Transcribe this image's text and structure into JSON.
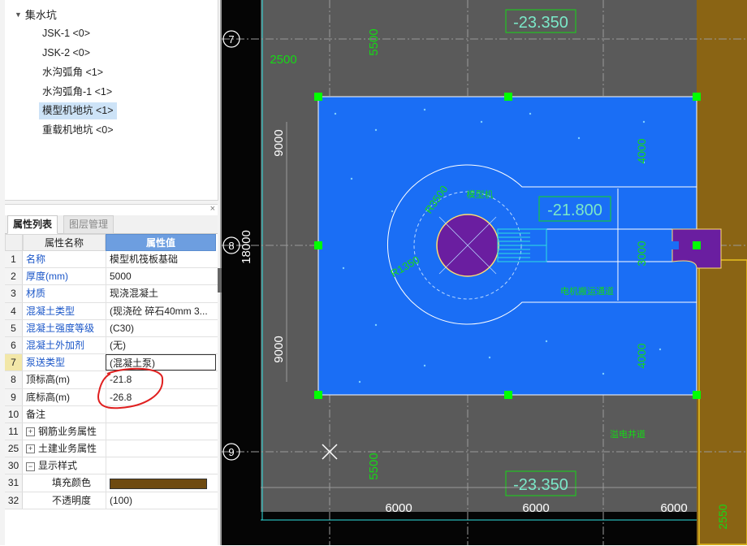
{
  "tree": {
    "root_label": "集水坑",
    "items": [
      {
        "label": "JSK-1 <0>",
        "selected": false
      },
      {
        "label": "JSK-2 <0>",
        "selected": false
      },
      {
        "label": "水沟弧角 <1>",
        "selected": false
      },
      {
        "label": "水沟弧角-1 <1>",
        "selected": false
      },
      {
        "label": "模型机地坑 <1>",
        "selected": true
      },
      {
        "label": "重载机地坑 <0>",
        "selected": false
      }
    ]
  },
  "panel": {
    "close_glyph": "×",
    "tabs": [
      {
        "label": "属性列表",
        "active": true
      },
      {
        "label": "图层管理",
        "active": false
      }
    ],
    "headers": {
      "name": "属性名称",
      "value": "属性值"
    },
    "rows": [
      {
        "num": "1",
        "name": "名称",
        "value": "模型机筏板基础",
        "blue": true
      },
      {
        "num": "2",
        "name": "厚度(mm)",
        "value": "5000",
        "blue": true
      },
      {
        "num": "3",
        "name": "材质",
        "value": "现浇混凝土",
        "blue": true
      },
      {
        "num": "4",
        "name": "混凝土类型",
        "value": "(现浇砼 碎石40mm 3...",
        "blue": true
      },
      {
        "num": "5",
        "name": "混凝土强度等级",
        "value": "(C30)",
        "blue": true
      },
      {
        "num": "6",
        "name": "混凝土外加剂",
        "value": "(无)",
        "blue": true
      },
      {
        "num": "7",
        "name": "泵送类型",
        "value": "(混凝土泵)",
        "blue": true,
        "selected": true,
        "editing": true
      },
      {
        "num": "8",
        "name": "顶标高(m)",
        "value": "-21.8",
        "blue": false
      },
      {
        "num": "9",
        "name": "底标高(m)",
        "value": "-26.8",
        "blue": false
      },
      {
        "num": "10",
        "name": "备注",
        "value": "",
        "blue": false
      },
      {
        "num": "11",
        "name": "钢筋业务属性",
        "value": "",
        "blue": false,
        "expander": "+"
      },
      {
        "num": "25",
        "name": "土建业务属性",
        "value": "",
        "blue": false,
        "expander": "+"
      },
      {
        "num": "30",
        "name": "显示样式",
        "value": "",
        "blue": false,
        "expander": "−"
      },
      {
        "num": "31",
        "name": "填充颜色",
        "value": "",
        "blue": false,
        "indent": true,
        "swatch": "#6e4a10"
      },
      {
        "num": "32",
        "name": "不透明度",
        "value": "(100)",
        "blue": false,
        "indent": true
      }
    ]
  },
  "cad": {
    "grid_labels": [
      "7",
      "8",
      "9"
    ],
    "texts": {
      "elev_top": "-23.350",
      "elev_bottom": "-23.350",
      "elev_mid": "-21.800",
      "dim_5500_top": "5500",
      "dim_5500_bottom": "5500",
      "dim_2500": "2500",
      "dim_2550": "2550",
      "dim_9000_top": "9000",
      "dim_9000_bottom": "9000",
      "dim_18000": "18000",
      "dim_4000_top": "4000",
      "dim_4000_bottom": "4000",
      "dim_3000": "3000",
      "dim_6000_a": "6000",
      "dim_6000_b": "6000",
      "dim_6000_c": "6000",
      "r3500": "R3500",
      "r1350": "R1350",
      "lbl_model": "模型机",
      "lbl_channel": "电机搬运通道",
      "lbl_trench": "溢电井道"
    },
    "colors": {
      "background": "#050505",
      "slab": "#1a6ef5",
      "pit": "#6a1ea0",
      "grip": "#00ff00",
      "dim_text": "#16d816",
      "elev_text": "#7be8c8",
      "wall": "#5a5a5a",
      "brown": "#8a6414"
    }
  }
}
